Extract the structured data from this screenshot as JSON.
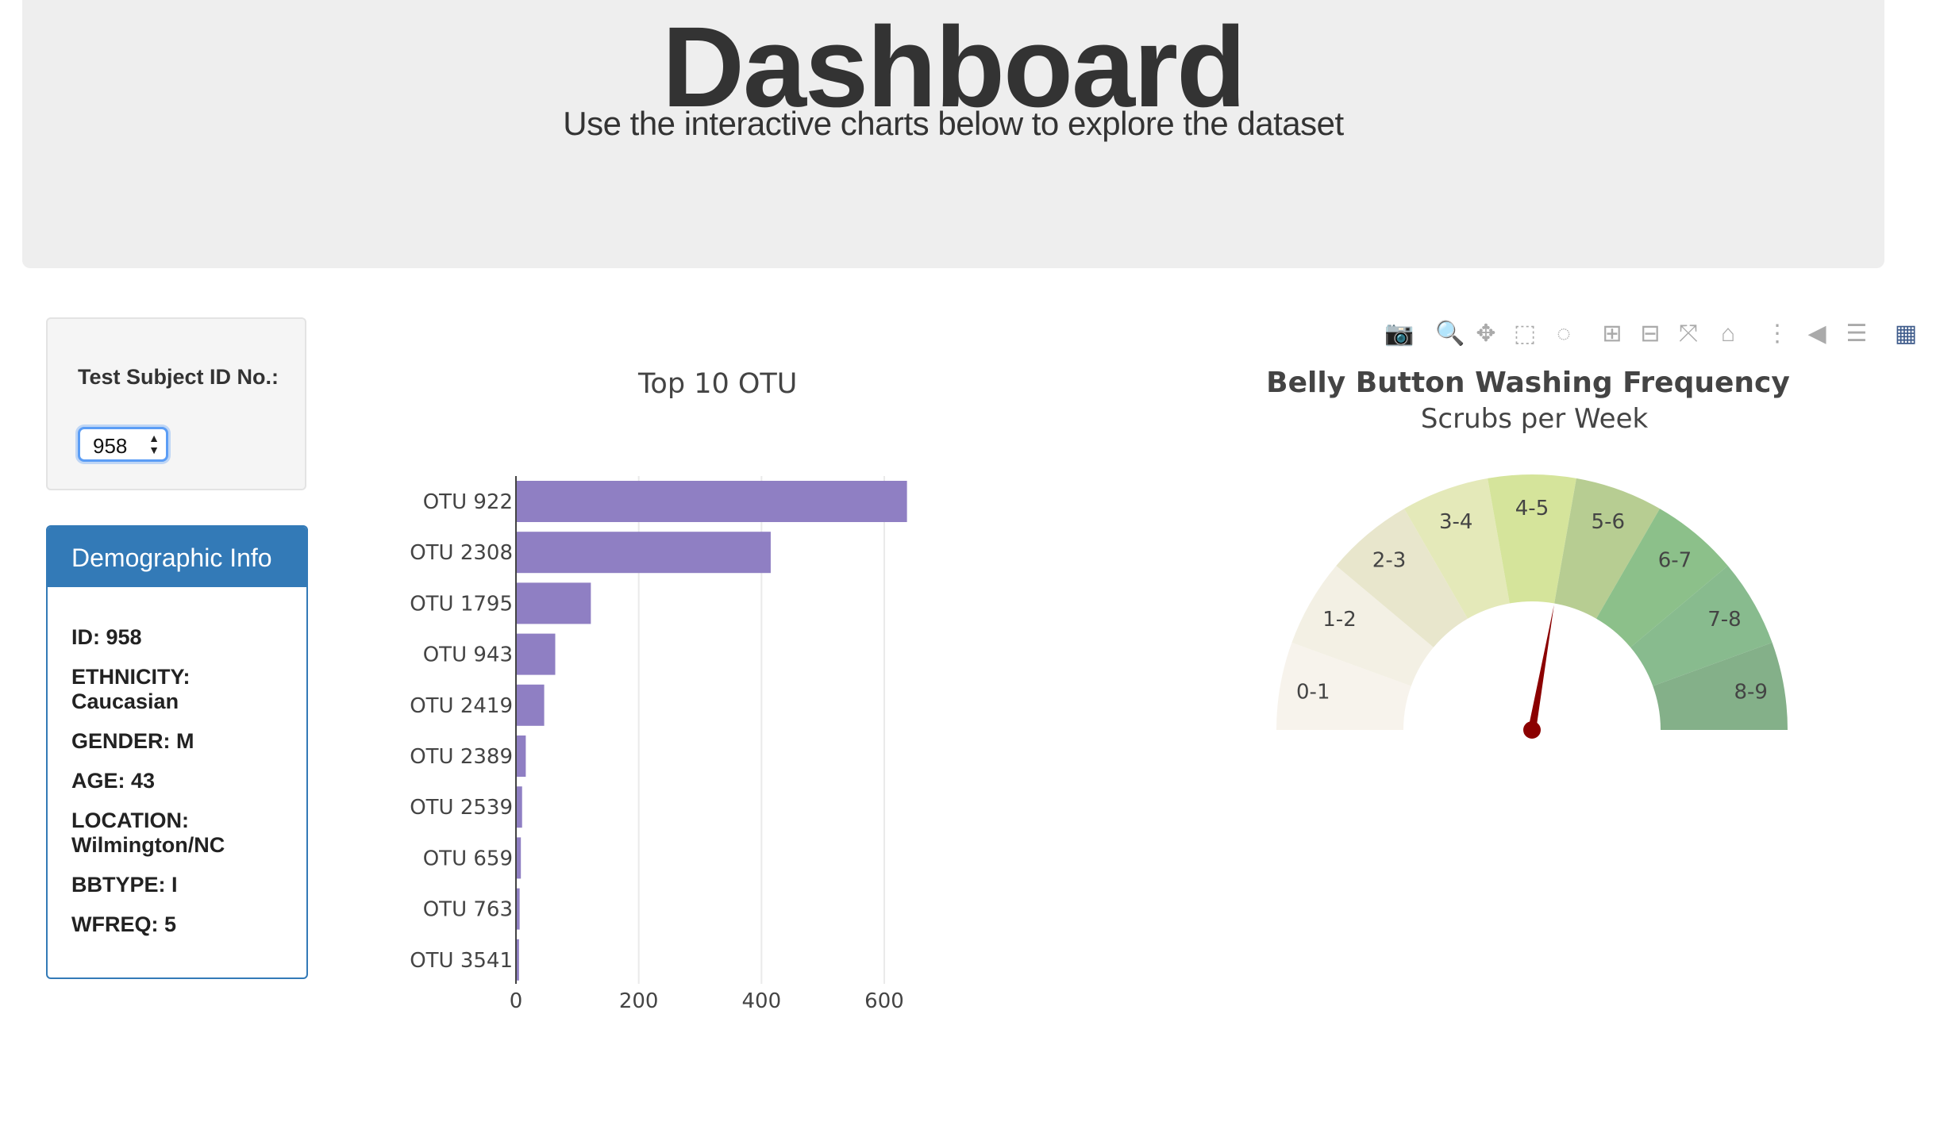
{
  "header": {
    "title": "Dashboard",
    "subtitle": "Use the interactive charts below to explore the dataset"
  },
  "selector": {
    "label": "Test Subject ID No.:",
    "selected": "958"
  },
  "demographics": {
    "heading": "Demographic Info",
    "lines": [
      "ID: 958",
      "ETHNICITY: Caucasian",
      "GENDER: M",
      "AGE: 43",
      "LOCATION: Wilmington/NC",
      "BBTYPE: I",
      "WFREQ: 5"
    ]
  },
  "modebar": {
    "icons": [
      "camera-icon",
      "zoom-icon",
      "pan-icon",
      "box-select-icon",
      "lasso-icon",
      "zoom-in-icon",
      "zoom-out-icon",
      "autoscale-icon",
      "reset-axes-icon",
      "spike-lines-icon",
      "hover-closest-icon",
      "hover-compare-icon",
      "plotly-logo-icon"
    ]
  },
  "chart_data": [
    {
      "type": "bar",
      "orientation": "horizontal",
      "title": "Top 10 OTU",
      "categories": [
        "OTU 922",
        "OTU 2308",
        "OTU 1795",
        "OTU 943",
        "OTU 2419",
        "OTU 2389",
        "OTU 2539",
        "OTU 659",
        "OTU 763",
        "OTU 3541"
      ],
      "values": [
        637,
        415,
        122,
        64,
        46,
        16,
        10,
        8,
        6,
        5
      ],
      "xticks": [
        0,
        200,
        400,
        600
      ],
      "xlim": [
        0,
        650
      ],
      "color": "#8f7fc3",
      "grid": true
    },
    {
      "type": "gauge",
      "title": "Belly Button Washing Frequency",
      "subtitle": "Scrubs per Week",
      "segments": [
        "0-1",
        "1-2",
        "2-3",
        "3-4",
        "4-5",
        "5-6",
        "6-7",
        "7-8",
        "8-9"
      ],
      "segment_colors": [
        "#f7f3ec",
        "#f3f0e4",
        "#e8e6cc",
        "#e4e9b9",
        "#d5e49b",
        "#b7cd92",
        "#8cc08a",
        "#88bb8e",
        "#84b089"
      ],
      "range": [
        0,
        9
      ],
      "value": 5,
      "needle_color": "#8b0000"
    }
  ]
}
